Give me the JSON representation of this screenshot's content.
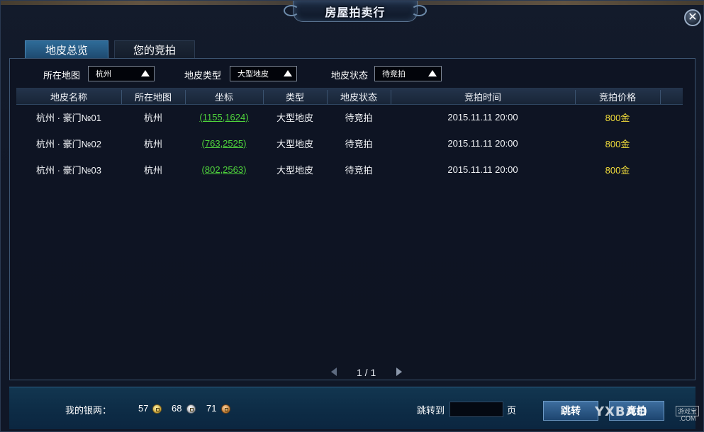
{
  "window": {
    "title": "房屋拍卖行",
    "close_symbol": "✕"
  },
  "tabs": [
    {
      "label": "地皮总览",
      "active": true
    },
    {
      "label": "您的竞拍",
      "active": false
    }
  ],
  "filters": {
    "map": {
      "label": "所在地图",
      "value": "杭州"
    },
    "type": {
      "label": "地皮类型",
      "value": "大型地皮"
    },
    "status": {
      "label": "地皮状态",
      "value": "待竞拍"
    }
  },
  "table": {
    "columns": [
      "地皮名称",
      "所在地图",
      "坐标",
      "类型",
      "地皮状态",
      "竞拍时间",
      "竞拍价格"
    ],
    "rows": [
      {
        "name": "杭州 · 豪门№01",
        "map": "杭州",
        "coord": "(1155,1624)",
        "type": "大型地皮",
        "status": "待竞拍",
        "time": "2015.11.11 20:00",
        "price": "800金"
      },
      {
        "name": "杭州 · 豪门№02",
        "map": "杭州",
        "coord": "(763,2525)",
        "type": "大型地皮",
        "status": "待竞拍",
        "time": "2015.11.11 20:00",
        "price": "800金"
      },
      {
        "name": "杭州 · 豪门№03",
        "map": "杭州",
        "coord": "(802,2563)",
        "type": "大型地皮",
        "status": "待竞拍",
        "time": "2015.11.11 20:00",
        "price": "800金"
      }
    ]
  },
  "pager": {
    "text": "1 / 1"
  },
  "footer": {
    "silver_label": "我的银两：",
    "gold": "57",
    "silver": "68",
    "copper": "71",
    "jump_label": "跳转到",
    "page_input_value": "",
    "page_unit": "页",
    "jump_button": "跳转",
    "bid_button": "竞拍"
  },
  "watermark": {
    "text": "YXBAO",
    "sub": "游戏宝",
    "com": ".COM"
  },
  "colors": {
    "coord_link": "#4fd43c",
    "price": "#f2dd3a",
    "tab_active": "#2f6c98"
  }
}
